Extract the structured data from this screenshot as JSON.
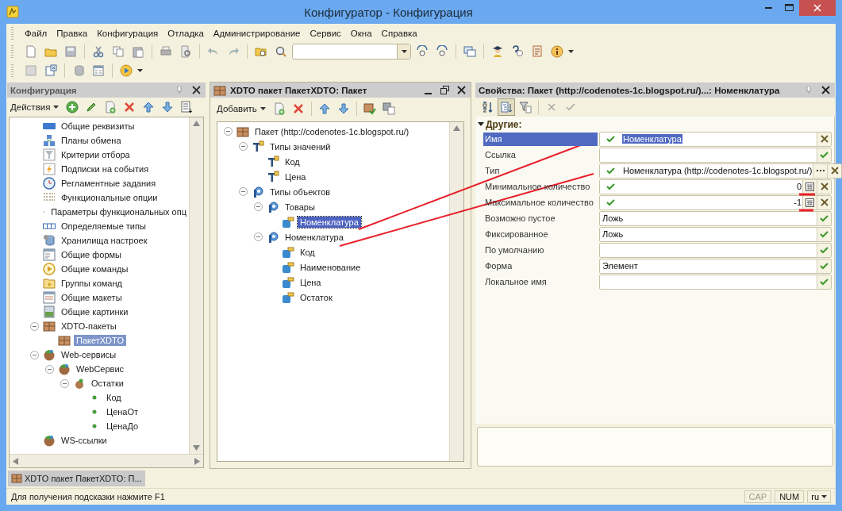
{
  "window": {
    "title": "Конфигуратор - Конфигурация"
  },
  "menu": [
    "Файл",
    "Правка",
    "Конфигурация",
    "Отладка",
    "Администрирование",
    "Сервис",
    "Окна",
    "Справка"
  ],
  "config_panel": {
    "title": "Конфигурация",
    "actions": "Действия",
    "tree": [
      {
        "label": "Общие реквизиты",
        "kind": "attribute",
        "selected": false
      },
      {
        "label": "Планы обмена",
        "kind": "exchange",
        "selected": false
      },
      {
        "label": "Критерии отбора",
        "kind": "filter",
        "selected": false
      },
      {
        "label": "Подписки на события",
        "kind": "subscription",
        "selected": false
      },
      {
        "label": "Регламентные задания",
        "kind": "schedule",
        "selected": false
      },
      {
        "label": "Функциональные опции",
        "kind": "option",
        "selected": false
      },
      {
        "label": "Параметры функциональных опц",
        "kind": "parameter",
        "selected": false
      },
      {
        "label": "Определяемые типы",
        "kind": "deftype",
        "selected": false
      },
      {
        "label": "Хранилища настроек",
        "kind": "storage",
        "selected": false
      },
      {
        "label": "Общие формы",
        "kind": "form",
        "selected": false
      },
      {
        "label": "Общие команды",
        "kind": "command",
        "selected": false
      },
      {
        "label": "Группы команд",
        "kind": "group",
        "selected": false
      },
      {
        "label": "Общие макеты",
        "kind": "template",
        "selected": false
      },
      {
        "label": "Общие картинки",
        "kind": "picture",
        "selected": false
      },
      {
        "label": "XDTO-пакеты",
        "kind": "xdto",
        "selected": false,
        "expanded": true,
        "children": [
          {
            "label": "ПакетXDTO",
            "kind": "xdto",
            "selected": true
          }
        ]
      },
      {
        "label": "Web-сервисы",
        "kind": "web",
        "selected": false,
        "expanded": true,
        "children": [
          {
            "label": "WebСервис",
            "kind": "web",
            "selected": false,
            "expanded": true,
            "children": [
              {
                "label": "Остатки",
                "kind": "operation",
                "selected": false,
                "expanded": true,
                "children": [
                  {
                    "label": "Код",
                    "kind": "param",
                    "selected": false
                  },
                  {
                    "label": "ЦенаОт",
                    "kind": "param",
                    "selected": false
                  },
                  {
                    "label": "ЦенаДо",
                    "kind": "param",
                    "selected": false
                  }
                ]
              }
            ]
          }
        ]
      },
      {
        "label": "WS-ссылки",
        "kind": "web",
        "selected": false
      }
    ]
  },
  "package_panel": {
    "title": "XDTO пакет ПакетXDTO: Пакет",
    "add": "Добавить",
    "tree": [
      {
        "label": "Пакет (http://codenotes-1c.blogspot.ru/)",
        "kind": "package",
        "selected": false,
        "expanded": true,
        "children": [
          {
            "label": "Типы значений",
            "kind": "value-type",
            "selected": false,
            "expanded": true,
            "children": [
              {
                "label": "Код",
                "kind": "value-type",
                "selected": false
              },
              {
                "label": "Цена",
                "kind": "value-type",
                "selected": false
              }
            ]
          },
          {
            "label": "Типы объектов",
            "kind": "object-type",
            "selected": false,
            "expanded": true,
            "children": [
              {
                "label": "Товары",
                "kind": "object-type",
                "selected": false,
                "expanded": true,
                "children": [
                  {
                    "label": "Номенклатура",
                    "kind": "property",
                    "selected": true
                  }
                ]
              },
              {
                "label": "Номенклатура",
                "kind": "object-type",
                "selected": false,
                "expanded": true,
                "children": [
                  {
                    "label": "Код",
                    "kind": "property",
                    "selected": false
                  },
                  {
                    "label": "Наименование",
                    "kind": "property",
                    "selected": false
                  },
                  {
                    "label": "Цена",
                    "kind": "property",
                    "selected": false
                  },
                  {
                    "label": "Остаток",
                    "kind": "property",
                    "selected": false
                  }
                ]
              }
            ]
          }
        ]
      }
    ]
  },
  "properties_panel": {
    "title": "Свойства: Пакет (http://codenotes-1c.blogspot.ru/)...: Номенклатура",
    "categorized": true,
    "group": {
      "label": "Другие:",
      "expanded": true
    },
    "rows": [
      {
        "label": "Имя",
        "kind": "text",
        "value": "Номенклатура",
        "selected": true
      },
      {
        "label": "Ссылка",
        "kind": "choice",
        "selected": false
      },
      {
        "label": "Тип",
        "kind": "type",
        "value": "Номенклатура (http://codenotes-1c.blogspot.ru/)",
        "selected": false
      },
      {
        "label": "Минимальное количество",
        "kind": "number",
        "value": "0",
        "selected": false
      },
      {
        "label": "Максимальное количество",
        "kind": "number",
        "value": "-1",
        "selected": false
      },
      {
        "label": "Возможно пустое",
        "kind": "choice",
        "value": "Ложь",
        "selected": false
      },
      {
        "label": "Фиксированное",
        "kind": "choice",
        "value": "Ложь",
        "selected": false
      },
      {
        "label": "По умолчанию",
        "kind": "choice",
        "selected": false
      },
      {
        "label": "Форма",
        "kind": "choice",
        "value": "Элемент",
        "selected": false
      },
      {
        "label": "Локальное имя",
        "kind": "choice",
        "selected": false
      }
    ]
  },
  "window_tabs": [
    {
      "label": "XDTO пакет ПакетXDTO: П...",
      "selected": true
    }
  ],
  "status_bar": {
    "hint": "Для получения подсказки нажмите F1",
    "indicators": [
      {
        "label": "CAP",
        "disabled": true
      },
      {
        "label": "NUM",
        "disabled": false
      }
    ],
    "language": "ru"
  }
}
